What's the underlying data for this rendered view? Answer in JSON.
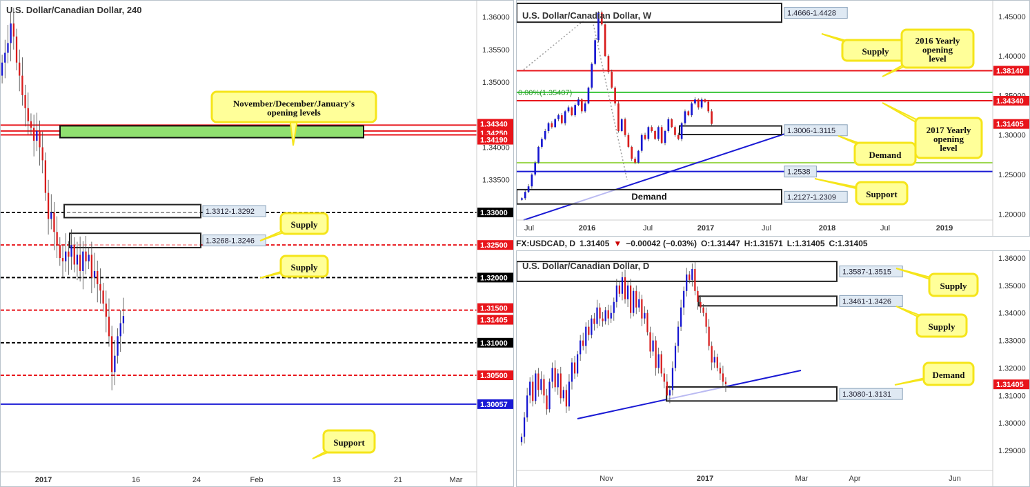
{
  "panels": {
    "h4": {
      "title": "U.S. Dollar/Canadian Dollar, 240"
    },
    "weekly": {
      "title": "U.S. Dollar/Canadian Dollar, W"
    },
    "daily": {
      "title": "U.S. Dollar/Canadian Dollar, D"
    }
  },
  "infobar": {
    "symbol": "FX:USDCAD, D",
    "price": "1.31405",
    "arrow": "▼",
    "change": "−0.00042 (−0.03%)",
    "o": "O:1.31447",
    "h": "H:1.31571",
    "l": "L:1.31405",
    "c": "C:1.31405"
  },
  "colors": {
    "bull": "#1515d0",
    "bear": "#d81b1b",
    "red_level": "#e8151b",
    "black_level": "#000000",
    "green_zone": "#90e070",
    "callout": "#ffff99",
    "callout_border": "#f5e51a"
  },
  "chart_data": [
    {
      "id": "h4",
      "type": "candlestick",
      "title": "U.S. Dollar/Canadian Dollar, 240",
      "ylim": [
        1.2905,
        1.3625
      ],
      "y_ticks": [
        "1.36000",
        "1.35500",
        "1.35000",
        "1.34000",
        "1.33500"
      ],
      "x_ticks": [
        "2017",
        "16",
        "24",
        "Feb",
        "13",
        "21",
        "Mar"
      ],
      "price_labels": [
        "1.34340",
        "1.34250",
        "1.34190",
        "1.33000",
        "1.32500",
        "1.32000",
        "1.31500",
        "1.31405",
        "1.31000",
        "1.30500",
        "1.30057"
      ],
      "levels": [
        {
          "value": 1.3434,
          "style": "solid-red"
        },
        {
          "value": 1.3425,
          "style": "solid-red"
        },
        {
          "value": 1.3419,
          "style": "solid-red"
        },
        {
          "value": 1.33,
          "style": "dashed-black"
        },
        {
          "value": 1.325,
          "style": "dashed-red"
        },
        {
          "value": 1.32,
          "style": "dashed-black"
        },
        {
          "value": 1.315,
          "style": "dashed-red"
        },
        {
          "value": 1.31,
          "style": "dashed-black"
        },
        {
          "value": 1.305,
          "style": "dashed-red"
        },
        {
          "value": 1.30057,
          "style": "solid-blue"
        }
      ],
      "zones": [
        {
          "label": "1.3312-1.3292",
          "top": 1.3312,
          "bottom": 1.3292
        },
        {
          "label": "1.3268-1.3246",
          "top": 1.3268,
          "bottom": 1.3246
        }
      ],
      "green_zone": {
        "top": 1.3434,
        "bottom": 1.3419
      },
      "callouts": [
        {
          "text": "November/December/January's opening levels"
        },
        {
          "text": "Supply"
        },
        {
          "text": "Supply"
        },
        {
          "text": "Support"
        }
      ],
      "closes": [
        1.353,
        1.3545,
        1.356,
        1.359,
        1.357,
        1.353,
        1.351,
        1.348,
        1.346,
        1.344,
        1.343,
        1.341,
        1.3425,
        1.34,
        1.338,
        1.333,
        1.329,
        1.33,
        1.327,
        1.325,
        1.323,
        1.3225,
        1.324,
        1.3232,
        1.325,
        1.322,
        1.3235,
        1.321,
        1.324,
        1.3225,
        1.3235,
        1.32,
        1.321,
        1.319,
        1.318,
        1.316,
        1.314,
        1.311,
        1.3055,
        1.308,
        1.311,
        1.313,
        1.3141
      ]
    },
    {
      "id": "weekly",
      "type": "candlestick",
      "title": "U.S. Dollar/Canadian Dollar, W",
      "ylim": [
        1.195,
        1.47
      ],
      "y_ticks": [
        "1.45000",
        "1.40000",
        "1.35000",
        "1.30000",
        "1.25000",
        "1.20000"
      ],
      "x_ticks": [
        "Jul",
        "2016",
        "Jul",
        "2017",
        "Jul",
        "2018",
        "Jul",
        "2019"
      ],
      "price_labels": [
        "1.38140",
        "1.34340",
        "1.31405"
      ],
      "levels": [
        {
          "value": 1.3814,
          "style": "solid-red"
        },
        {
          "value": 1.3434,
          "style": "solid-red"
        },
        {
          "value": 1.354,
          "style": "solid-green",
          "label": "0.00%(1.35407)"
        },
        {
          "value": 1.265,
          "style": "solid-lightgreen"
        },
        {
          "value": 1.2538,
          "style": "solid-blue"
        }
      ],
      "zones": [
        {
          "label": "1.4666-1.4428",
          "top": 1.4666,
          "bottom": 1.4428
        },
        {
          "label": "1.3006-1.3115",
          "top": 1.3115,
          "bottom": 1.3006
        },
        {
          "label": "1.2538",
          "top": 1.2538,
          "bottom": 1.2538
        },
        {
          "label": "1.2127-1.2309",
          "top": 1.2309,
          "bottom": 1.2127
        }
      ],
      "zone_texts": [
        "Demand"
      ],
      "callouts": [
        {
          "text": "Supply"
        },
        {
          "text": "2016 Yearly opening level"
        },
        {
          "text": "2017 Yearly opening level"
        },
        {
          "text": "Demand"
        },
        {
          "text": "Support"
        }
      ],
      "closes": [
        1.22,
        1.228,
        1.235,
        1.25,
        1.265,
        1.285,
        1.295,
        1.305,
        1.315,
        1.31,
        1.32,
        1.325,
        1.315,
        1.33,
        1.335,
        1.325,
        1.338,
        1.345,
        1.33,
        1.34,
        1.36,
        1.39,
        1.42,
        1.455,
        1.44,
        1.4,
        1.38,
        1.36,
        1.34,
        1.305,
        1.32,
        1.3,
        1.285,
        1.27,
        1.265,
        1.28,
        1.3,
        1.295,
        1.31,
        1.305,
        1.295,
        1.31,
        1.29,
        1.305,
        1.32,
        1.31,
        1.3,
        1.295,
        1.315,
        1.33,
        1.325,
        1.34,
        1.345,
        1.335,
        1.345,
        1.342,
        1.33,
        1.3141
      ]
    },
    {
      "id": "daily",
      "type": "candlestick",
      "title": "U.S. Dollar/Canadian Dollar, D",
      "ylim": [
        1.2835,
        1.3625
      ],
      "y_ticks": [
        "1.36000",
        "1.35000",
        "1.34000",
        "1.33000",
        "1.32000",
        "1.31000",
        "1.30000",
        "1.29000"
      ],
      "x_ticks": [
        "Nov",
        "2017",
        "Mar",
        "Apr",
        "Jun"
      ],
      "price_labels": [
        "1.31405"
      ],
      "zones": [
        {
          "label": "1.3587-1.3515",
          "top": 1.3587,
          "bottom": 1.3515
        },
        {
          "label": "1.3461-1.3426",
          "top": 1.3461,
          "bottom": 1.3426
        },
        {
          "label": "1.3080-1.3131",
          "top": 1.3131,
          "bottom": 1.308
        }
      ],
      "callouts": [
        {
          "text": "Supply"
        },
        {
          "text": "Supply"
        },
        {
          "text": "Demand"
        }
      ],
      "closes": [
        1.295,
        1.302,
        1.31,
        1.315,
        1.308,
        1.318,
        1.312,
        1.316,
        1.31,
        1.305,
        1.315,
        1.32,
        1.313,
        1.318,
        1.309,
        1.312,
        1.306,
        1.315,
        1.322,
        1.318,
        1.325,
        1.33,
        1.328,
        1.335,
        1.332,
        1.338,
        1.336,
        1.342,
        1.338,
        1.337,
        1.341,
        1.338,
        1.34,
        1.344,
        1.35,
        1.347,
        1.353,
        1.345,
        1.35,
        1.34,
        1.348,
        1.342,
        1.345,
        1.338,
        1.34,
        1.333,
        1.326,
        1.33,
        1.32,
        1.325,
        1.318,
        1.315,
        1.31,
        1.312,
        1.32,
        1.328,
        1.335,
        1.342,
        1.348,
        1.354,
        1.352,
        1.356,
        1.348,
        1.344,
        1.342,
        1.34,
        1.335,
        1.328,
        1.322,
        1.324,
        1.32,
        1.318,
        1.315,
        1.3141
      ]
    }
  ]
}
